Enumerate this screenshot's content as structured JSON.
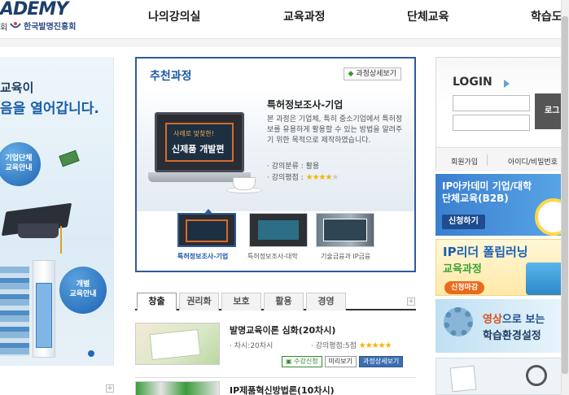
{
  "header": {
    "logo_text": "ADEMY",
    "logo_sub": "회",
    "org_name": "한국발명진흥회",
    "nav": [
      "나의강의실",
      "교육과정",
      "단체교육",
      "학습도"
    ]
  },
  "banner": {
    "line1": "교육이",
    "line2": "음을 열어갑니다.",
    "bubble1": "기업단체\n교육안내",
    "bubble2": "개별\n교육안내"
  },
  "recommend": {
    "title": "추천과정",
    "more_label": "과정상세보기",
    "course_title": "특허정보조사-기업",
    "course_desc": "본 과정은 기업체, 특히 중소기업에서 특허정보를 유용하게 활용할 수 있는 방법을 알려주기 위한 목적으로 제작하였습니다.",
    "category_label": "· 강의분류 : 활용",
    "rating_label": "· 강의평점 :",
    "rating": 4,
    "rating_max": 5,
    "screen_caption_small": "사례로 맞찾한!",
    "screen_caption_big": "신제품 개발편",
    "thumbs": [
      {
        "label": "특허정보조사-기업"
      },
      {
        "label": "특허정보조사-대학"
      },
      {
        "label": "기술금융과 IP금융"
      }
    ]
  },
  "tabs": [
    "창출",
    "권리화",
    "보호",
    "활용",
    "경영"
  ],
  "courses": [
    {
      "title": "발명교육이론 심화(20차시)",
      "sessions": "· 차시:20차시",
      "rating_label": "· 강의평점:5점",
      "rating": 5,
      "buttons": [
        "수강신청",
        "미리보기",
        "과정상세보기"
      ]
    },
    {
      "title": "IP제품혁신방법론(10차시)"
    }
  ],
  "login": {
    "title": "LOGIN",
    "login_button": "로그",
    "join_label": "회원가입",
    "find_label": "아이디/비밀번호"
  },
  "promos": {
    "b2b_title1": "IP아카데미 기업/대학",
    "b2b_title2": "단체교육(B2B)",
    "b2b_button": "신청하기",
    "leader_title1": "IP리더 폴립러닝",
    "leader_title2": "교육과정",
    "leader_button": "신청마감",
    "env_title1_hl": "영상",
    "env_title1_rest": "으로 보는",
    "env_title2": "학습환경설정"
  }
}
